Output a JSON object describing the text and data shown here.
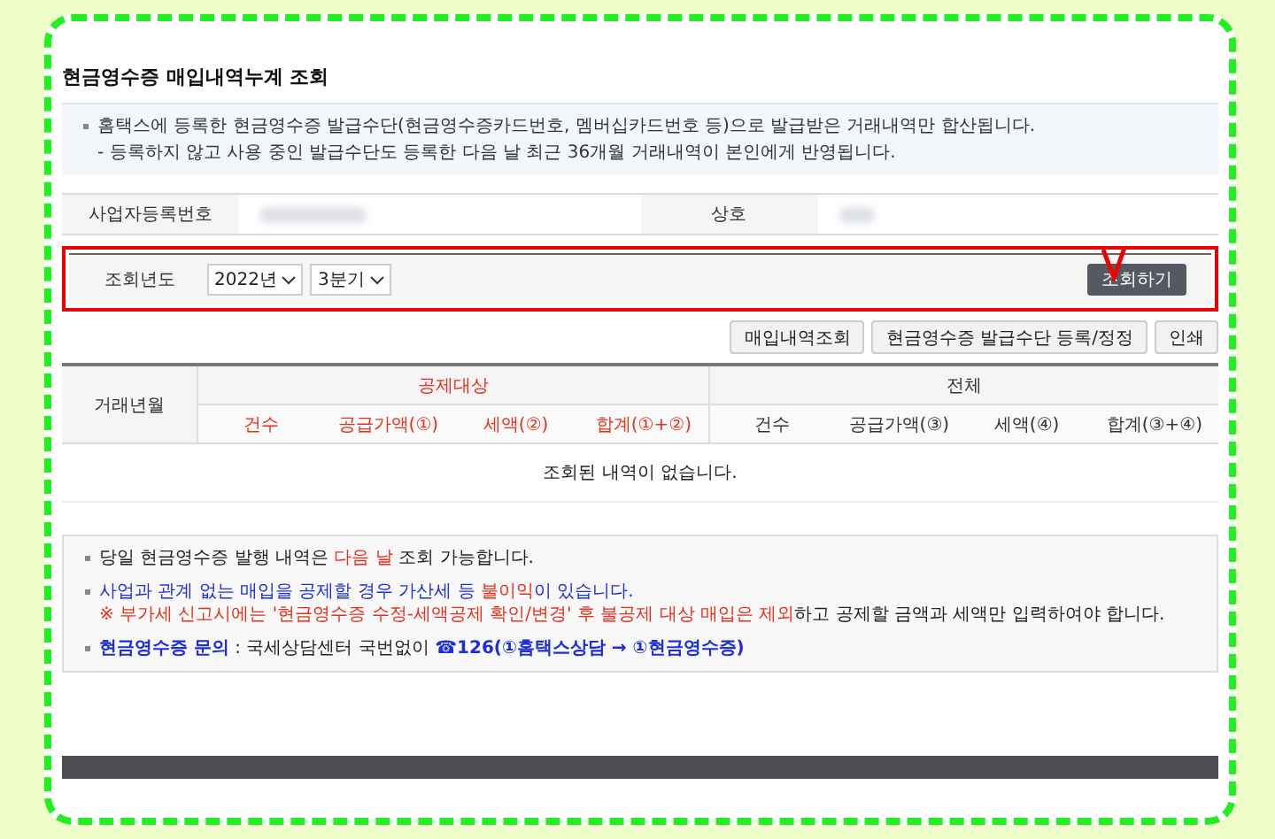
{
  "title": "현금영수증 매입내역누계 조회",
  "info": [
    "홈택스에 등록한 현금영수증 발급수단(현금영수증카드번호, 멤버십카드번호 등)으로 발급받은 거래내역만 합산됩니다.",
    "- 등록하지 않고 사용 중인 발급수단도 등록한 다음 날 최근 36개월 거래내역이 본인에게 반영됩니다."
  ],
  "business": {
    "number_label": "사업자등록번호",
    "name_label": "상호"
  },
  "query": {
    "label": "조회년도",
    "year": "2022년",
    "quarter": "3분기",
    "button": "조회하기",
    "highlighted": true
  },
  "actions": [
    "매입내역조회",
    "현금영수증 발급수단 등록/정정",
    "인쇄"
  ],
  "table": {
    "row_header": "거래년월",
    "groups": [
      {
        "label": "공제대상",
        "kind": "red",
        "columns": [
          "건수",
          "공급가액(①)",
          "세액(②)",
          "합계(①+②)"
        ]
      },
      {
        "label": "전체",
        "kind": "plain",
        "columns": [
          "건수",
          "공급가액(③)",
          "세액(④)",
          "합계(③+④)"
        ]
      }
    ],
    "empty": "조회된 내역이 없습니다."
  },
  "notes": [
    {
      "lines": [
        [
          {
            "text": "당일 현금영수증 발행 내역은 ",
            "kind": "plain"
          },
          {
            "text": "다음 날",
            "kind": "red"
          },
          {
            "text": " 조회 가능합니다.",
            "kind": "plain"
          }
        ]
      ]
    },
    {
      "lines": [
        [
          {
            "text": "사업과 관계 없는 매입을 공제할 경우 가산세 등 ",
            "kind": "blue"
          },
          {
            "text": "불이익",
            "kind": "red"
          },
          {
            "text": "이 있습니다.",
            "kind": "blue"
          }
        ],
        [
          {
            "text": "※ 부가세 신고시에는 '현금영수증 수정-세액공제 확인/변경' 후 불공제 대상 매입은 제외",
            "kind": "red"
          },
          {
            "text": "하고 공제할 금액과 세액만 입력하여야 합니다.",
            "kind": "plain"
          }
        ]
      ]
    },
    {
      "lines": [
        [
          {
            "text": "현금영수증 문의",
            "kind": "blue"
          },
          {
            "text": " : 국세상담센터 국번없이 ",
            "kind": "plain"
          },
          {
            "text": "☎126(①홈택스상담 → ①현금영수증)",
            "kind": "blue"
          }
        ]
      ]
    }
  ]
}
